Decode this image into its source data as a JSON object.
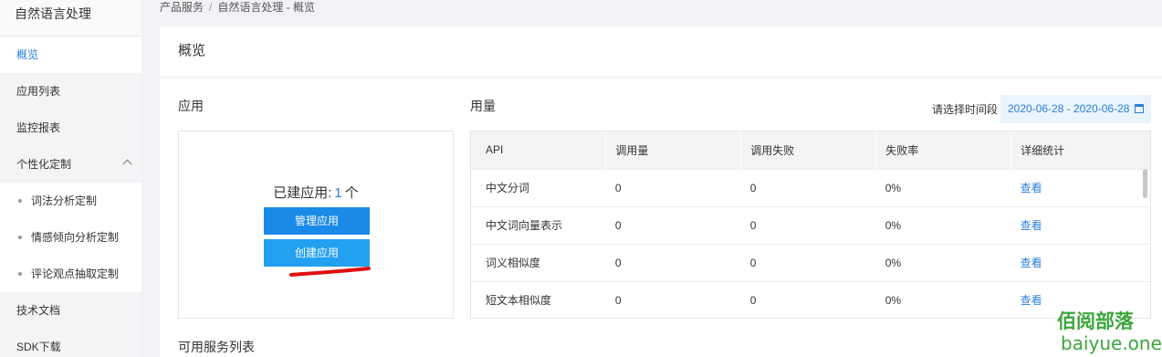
{
  "sidebar": {
    "title": "自然语言处理",
    "items": [
      {
        "label": "概览"
      },
      {
        "label": "应用列表"
      },
      {
        "label": "监控报表"
      },
      {
        "label": "个性化定制"
      },
      {
        "label": "技术文档"
      },
      {
        "label": "SDK下载"
      }
    ],
    "sub_items": [
      {
        "label": "词法分析定制"
      },
      {
        "label": "情感倾向分析定制"
      },
      {
        "label": "评论观点抽取定制"
      }
    ]
  },
  "breadcrumb": {
    "part1": "产品服务",
    "sep": "/",
    "part2": "自然语言处理 - 概览"
  },
  "card": {
    "title": "概览"
  },
  "apps": {
    "section_title": "应用",
    "count_prefix": "已建应用:",
    "count": "1",
    "count_suffix": "个",
    "manage_label": "管理应用",
    "create_label": "创建应用"
  },
  "usage": {
    "section_title": "用量",
    "date_label": "请选择时间段",
    "date_range": "2020-06-28 - 2020-06-28",
    "columns": [
      "API",
      "调用量",
      "调用失败",
      "失败率",
      "详细统计"
    ],
    "rows": [
      {
        "api": "中文分词",
        "calls": "0",
        "failures": "0",
        "rate": "0%",
        "link": "查看"
      },
      {
        "api": "中文词向量表示",
        "calls": "0",
        "failures": "0",
        "rate": "0%",
        "link": "查看"
      },
      {
        "api": "词义相似度",
        "calls": "0",
        "failures": "0",
        "rate": "0%",
        "link": "查看"
      },
      {
        "api": "短文本相似度",
        "calls": "0",
        "failures": "0",
        "rate": "0%",
        "link": "查看"
      }
    ]
  },
  "services": {
    "title": "可用服务列表"
  },
  "watermark": {
    "top": "佰阅部落",
    "bottom": "baiyue.one"
  },
  "colors": {
    "accent": "#2b7fd9",
    "button_primary": "#1a8ae6",
    "button_secondary": "#23a0ef",
    "watermark": "#3ba73b"
  }
}
